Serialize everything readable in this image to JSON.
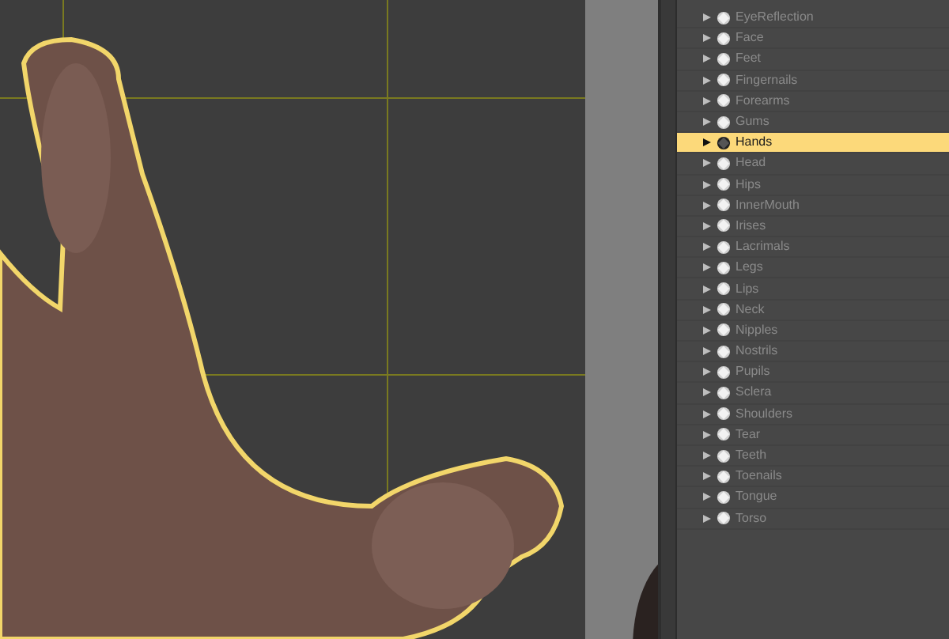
{
  "surfaces": [
    {
      "label": "EyeReflection",
      "selected": false
    },
    {
      "label": "Face",
      "selected": false
    },
    {
      "label": "Feet",
      "selected": false
    },
    {
      "label": "Fingernails",
      "selected": false
    },
    {
      "label": "Forearms",
      "selected": false
    },
    {
      "label": "Gums",
      "selected": false
    },
    {
      "label": "Hands",
      "selected": true
    },
    {
      "label": "Head",
      "selected": false
    },
    {
      "label": "Hips",
      "selected": false
    },
    {
      "label": "InnerMouth",
      "selected": false
    },
    {
      "label": "Irises",
      "selected": false
    },
    {
      "label": "Lacrimals",
      "selected": false
    },
    {
      "label": "Legs",
      "selected": false
    },
    {
      "label": "Lips",
      "selected": false
    },
    {
      "label": "Neck",
      "selected": false
    },
    {
      "label": "Nipples",
      "selected": false
    },
    {
      "label": "Nostrils",
      "selected": false
    },
    {
      "label": "Pupils",
      "selected": false
    },
    {
      "label": "Sclera",
      "selected": false
    },
    {
      "label": "Shoulders",
      "selected": false
    },
    {
      "label": "Tear",
      "selected": false
    },
    {
      "label": "Teeth",
      "selected": false
    },
    {
      "label": "Toenails",
      "selected": false
    },
    {
      "label": "Tongue",
      "selected": false
    },
    {
      "label": "Torso",
      "selected": false
    }
  ]
}
